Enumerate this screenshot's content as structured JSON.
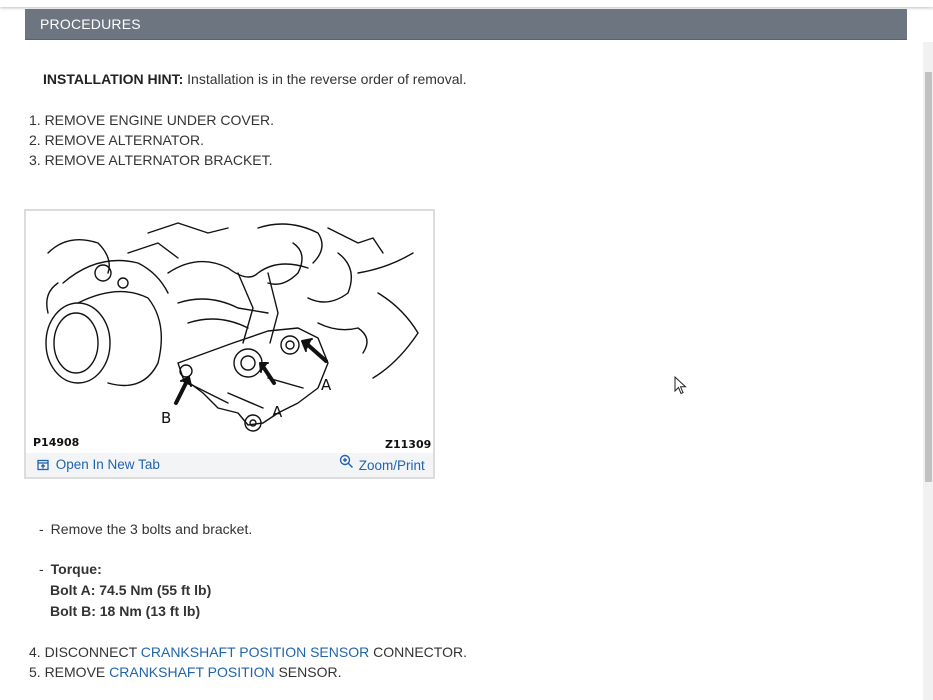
{
  "header": {
    "title": "PROCEDURES"
  },
  "hint": {
    "label": "INSTALLATION HINT:",
    "text": " Installation is in the reverse order of removal."
  },
  "steps_top": [
    "1. REMOVE ENGINE UNDER COVER.",
    "2. REMOVE ALTERNATOR.",
    "3. REMOVE ALTERNATOR BRACKET."
  ],
  "figure": {
    "code_left": "P14908",
    "code_right": "Z11309",
    "label_a": "A",
    "label_b": "B",
    "open_tab_label": "Open In New Tab",
    "zoom_label": "Zoom/Print",
    "icons": [
      "open-tab-icon",
      "zoom-icon"
    ]
  },
  "notes": {
    "remove_bullet": "-",
    "remove_text": "Remove the 3 bolts and bracket.",
    "torque_bullet": "-",
    "torque_label": "Torque:",
    "bolt_a": "Bolt A: 74.5 Nm (55 ft lb)",
    "bolt_b": "Bolt B: 18 Nm (13 ft lb)"
  },
  "steps_bottom": [
    {
      "prefix": "4. DISCONNECT ",
      "link": "CRANKSHAFT POSITION SENSOR",
      "suffix": " CONNECTOR."
    },
    {
      "prefix": "5. REMOVE ",
      "link": "CRANKSHAFT POSITION",
      "suffix": " SENSOR."
    }
  ],
  "colors": {
    "header_bg": "#6c7580",
    "link": "#2164ad",
    "text": "#333333"
  }
}
